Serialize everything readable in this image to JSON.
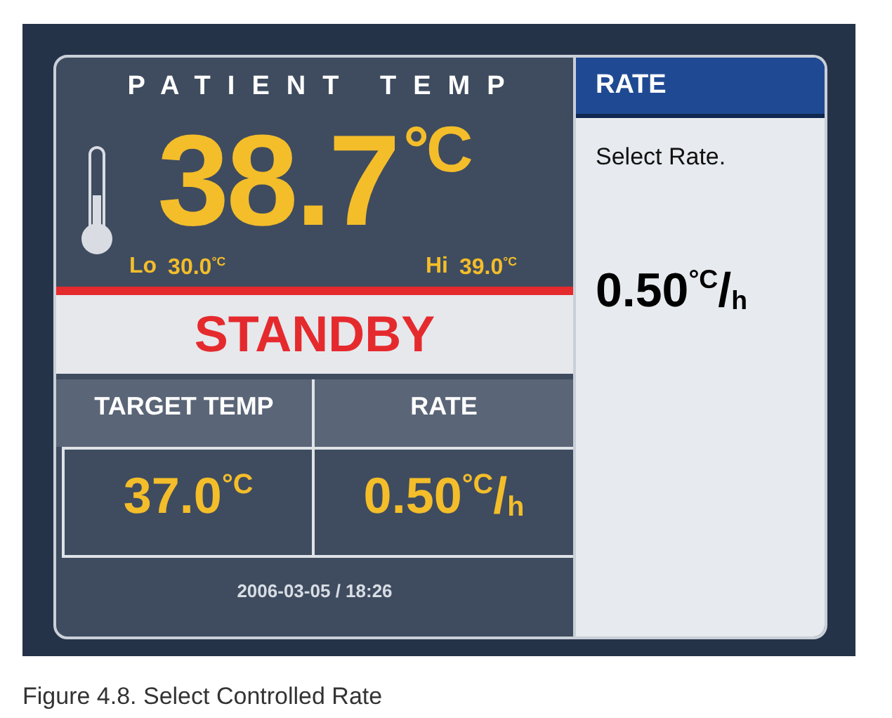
{
  "patient_temp": {
    "title": "PATIENT TEMP",
    "value": "38.7",
    "unit": "°C",
    "lo_label": "Lo",
    "lo_value": "30.0$^{°C}$",
    "hi_label": "Hi",
    "hi_value": "39.0$^{°C}$"
  },
  "status": "STANDBY",
  "settings": [
    {
      "label": "TARGET TEMP",
      "value": "37.0$^{°C}$"
    },
    {
      "label": "RATE",
      "value": "0.50$^{°C}$/$_{h}$"
    }
  ],
  "datetime": "2006-03-05 / 18:26",
  "side_panel": {
    "title": "RATE",
    "prompt": "Select Rate.",
    "value": "0.50$^{°C}$/$_{h}$"
  },
  "caption": "Figure 4.8. Select Controlled Rate"
}
